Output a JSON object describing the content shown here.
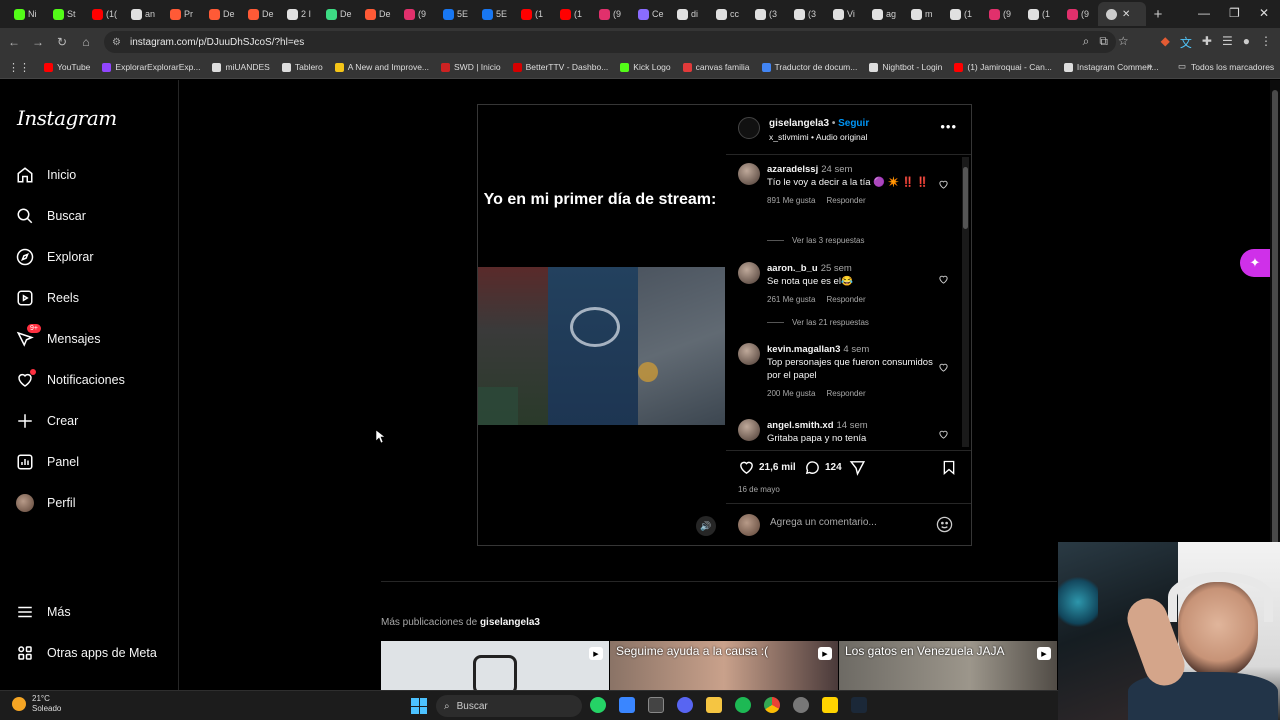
{
  "browser": {
    "tabs": [
      {
        "label": "Ni",
        "color": "#53fc18"
      },
      {
        "label": "St",
        "color": "#53fc18"
      },
      {
        "label": "(1(",
        "color": "#ff0000"
      },
      {
        "label": "an",
        "color": "#e0e0e0"
      },
      {
        "label": "Pr",
        "color": "#ff5a36"
      },
      {
        "label": "De",
        "color": "#ff5a36"
      },
      {
        "label": "De",
        "color": "#ff5a36"
      },
      {
        "label": "2 I",
        "color": "#e0e0e0"
      },
      {
        "label": "De",
        "color": "#3ddc84"
      },
      {
        "label": "De",
        "color": "#ff5a36"
      },
      {
        "label": "(9",
        "color": "#e1306c"
      },
      {
        "label": "5E",
        "color": "#1877f2"
      },
      {
        "label": "5E",
        "color": "#1877f2"
      },
      {
        "label": "(1",
        "color": "#ff0000"
      },
      {
        "label": "(1",
        "color": "#ff0000"
      },
      {
        "label": "(9",
        "color": "#e1306c"
      },
      {
        "label": "Ce",
        "color": "#8a6cff"
      },
      {
        "label": "di",
        "color": "#e0e0e0"
      },
      {
        "label": "cc",
        "color": "#e0e0e0"
      },
      {
        "label": "(3",
        "color": "#e0e0e0"
      },
      {
        "label": "(3",
        "color": "#e0e0e0"
      },
      {
        "label": "Vi",
        "color": "#e0e0e0"
      },
      {
        "label": "ag",
        "color": "#e0e0e0"
      },
      {
        "label": "m",
        "color": "#e0e0e0"
      },
      {
        "label": "(1",
        "color": "#e0e0e0"
      },
      {
        "label": "(9",
        "color": "#e1306c"
      },
      {
        "label": "(1",
        "color": "#e0e0e0"
      },
      {
        "label": "(9",
        "color": "#e1306c"
      }
    ],
    "url": "instagram.com/p/DJuuDhSJcoS/?hl=es",
    "bookmarks": [
      {
        "label": "YouTube",
        "color": "#ff0000"
      },
      {
        "label": "ExplorarExplorarExp...",
        "color": "#9146ff"
      },
      {
        "label": "miUANDES",
        "color": "#dddddd"
      },
      {
        "label": "Tablero",
        "color": "#dddddd"
      },
      {
        "label": "A New and Improve...",
        "color": "#f5c518"
      },
      {
        "label": "SWD | Inicio",
        "color": "#cc2222"
      },
      {
        "label": "BetterTTV - Dashbo...",
        "color": "#d50000"
      },
      {
        "label": "Kick Logo",
        "color": "#53fc18"
      },
      {
        "label": "canvas familia",
        "color": "#e13a3a"
      },
      {
        "label": "Traductor de docum...",
        "color": "#4285f4"
      },
      {
        "label": "Nightbot - Login",
        "color": "#dddddd"
      },
      {
        "label": "(1) Jamiroquai - Can...",
        "color": "#ff0000"
      },
      {
        "label": "Instagram Commen...",
        "color": "#dddddd"
      }
    ],
    "all_bookmarks": "Todos los marcadores"
  },
  "sidebar": {
    "logo": "Instagram",
    "items": [
      {
        "label": "Inicio",
        "icon": "home-icon"
      },
      {
        "label": "Buscar",
        "icon": "search-icon"
      },
      {
        "label": "Explorar",
        "icon": "compass-icon"
      },
      {
        "label": "Reels",
        "icon": "reels-icon"
      },
      {
        "label": "Mensajes",
        "icon": "messenger-icon",
        "badge": "9+"
      },
      {
        "label": "Notificaciones",
        "icon": "heart-icon"
      },
      {
        "label": "Crear",
        "icon": "plus-icon"
      },
      {
        "label": "Panel",
        "icon": "chart-icon"
      },
      {
        "label": "Perfil",
        "icon": "avatar"
      }
    ],
    "more": "Más",
    "meta": "Otras apps de Meta"
  },
  "post": {
    "overlay_text": "Yo en mi primer día de stream:",
    "author": "giselangela3",
    "follow": "Seguir",
    "audio": "x_stivmimi • Audio original",
    "likes": "21,6 mil",
    "comments_count": "124",
    "date": "16 de mayo",
    "comment_placeholder": "Agrega un comentario...",
    "comments": [
      {
        "user": "azaradelssj",
        "time": "24 sem",
        "text": "Tío le voy a decir a la tía 🟣 ✴️ ‼️ ‼️",
        "likes": "891 Me gusta",
        "reply": "Responder",
        "replies": "Ver las 3 respuestas"
      },
      {
        "user": "aaron._b_u",
        "time": "25 sem",
        "text": "Se nota que es el😂",
        "likes": "261 Me gusta",
        "reply": "Responder",
        "replies": "Ver las 21 respuestas"
      },
      {
        "user": "kevin.magallan3",
        "time": "4 sem",
        "text": "Top personajes que fueron consumidos por el papel",
        "likes": "200 Me gusta",
        "reply": "Responder",
        "replies": ""
      },
      {
        "user": "angel.smith.xd",
        "time": "14 sem",
        "text": "Gritaba papa y no tenía",
        "likes": "",
        "reply": "",
        "replies": ""
      }
    ]
  },
  "more_posts": {
    "prefix": "Más publicaciones de",
    "user": "giselangela3",
    "thumbs": [
      {
        "caption": ""
      },
      {
        "caption": "Seguime ayuda a la causa :("
      },
      {
        "caption": "Los gatos en Venezuela JAJA"
      }
    ]
  },
  "taskbar": {
    "temp": "21°C",
    "weather": "Soleado",
    "search": "Buscar"
  }
}
